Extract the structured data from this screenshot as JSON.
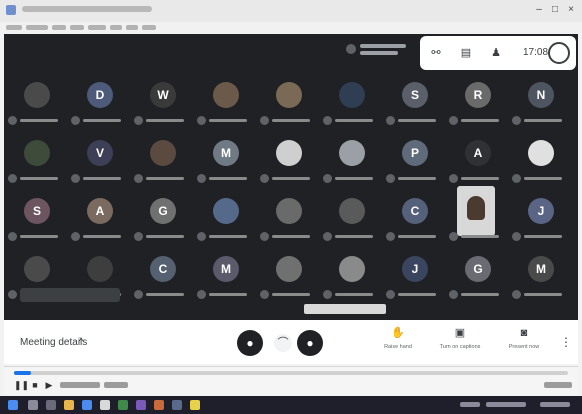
{
  "window": {
    "title": ""
  },
  "meeting": {
    "clock": "17:08",
    "controls": {
      "meeting_details_label": "Meeting details",
      "raise_hand_label": "Raise hand",
      "captions_label": "Turn on captions",
      "present_label": "Present now"
    }
  },
  "colors": {
    "stage_bg": "#202124",
    "accent": "#1a73e8",
    "tile_avatar_colors": [
      "#5f6368",
      "#4e5a7a",
      "#3a5f8f",
      "#6d4c41",
      "#455a64",
      "#7b5aa6"
    ]
  },
  "participants": [
    {
      "initial": "",
      "color": "#4a4a4a"
    },
    {
      "initial": "D",
      "color": "#4e5a7a"
    },
    {
      "initial": "W",
      "color": "#3a3a3a"
    },
    {
      "initial": "",
      "color": "#6b5a4a"
    },
    {
      "initial": "",
      "color": "#7a6a55"
    },
    {
      "initial": "",
      "color": "#2f3e52"
    },
    {
      "initial": "S",
      "color": "#5a5f6a"
    },
    {
      "initial": "R",
      "color": "#6a6a6a"
    },
    {
      "initial": "N",
      "color": "#4f5560"
    },
    {
      "initial": "",
      "color": "#3e4a3a"
    },
    {
      "initial": "V",
      "color": "#3c3f55"
    },
    {
      "initial": "",
      "color": "#5a4a40"
    },
    {
      "initial": "M",
      "color": "#707a85"
    },
    {
      "initial": "",
      "color": "#cfcfcf"
    },
    {
      "initial": "",
      "color": "#9aa0a6"
    },
    {
      "initial": "P",
      "color": "#5f6a7a"
    },
    {
      "initial": "A",
      "color": "#303134"
    },
    {
      "initial": "",
      "color": "#e0e0e0"
    },
    {
      "initial": "S",
      "color": "#6d5560"
    },
    {
      "initial": "A",
      "color": "#7a6a60"
    },
    {
      "initial": "G",
      "color": "#707070"
    },
    {
      "initial": "",
      "color": "#556a8a"
    },
    {
      "initial": "",
      "color": "#6a6a6a"
    },
    {
      "initial": "",
      "color": "#5a5a5a"
    },
    {
      "initial": "C",
      "color": "#55607a"
    },
    {
      "initial": "",
      "color": "video"
    },
    {
      "initial": "J",
      "color": "#5a6585"
    },
    {
      "initial": "",
      "color": "#4a4a4a"
    },
    {
      "initial": "",
      "color": "#3e3e3e"
    },
    {
      "initial": "C",
      "color": "#556070"
    },
    {
      "initial": "M",
      "color": "#5a5a6a"
    },
    {
      "initial": "",
      "color": "#707070"
    },
    {
      "initial": "",
      "color": "#8a8a8a"
    },
    {
      "initial": "J",
      "color": "#3a4560"
    },
    {
      "initial": "G",
      "color": "#6a6a72"
    },
    {
      "initial": "M",
      "color": "#4a4a4a"
    }
  ],
  "recording": {
    "progress": 0.03
  },
  "icons": {
    "self_view": "avatar",
    "people": "people-icon",
    "chat": "chat-icon",
    "activities": "activities-icon"
  }
}
